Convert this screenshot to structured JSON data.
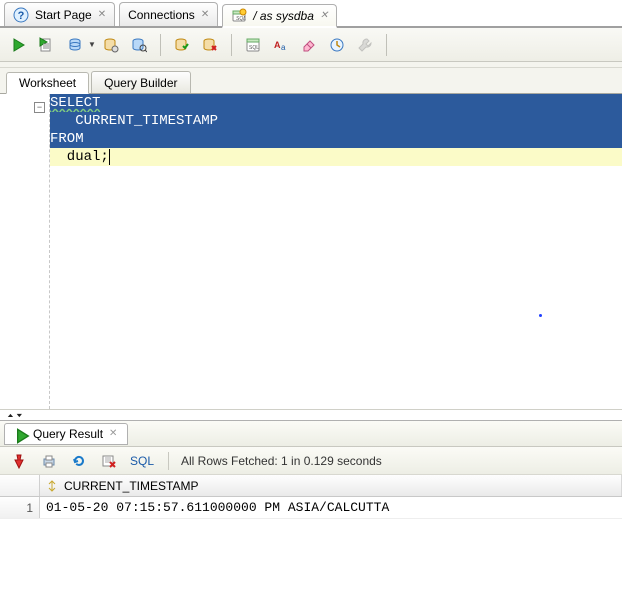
{
  "tabs": {
    "start": "Start Page",
    "connections": "Connections",
    "current": "/ as sysdba"
  },
  "worksheet": {
    "tab1": "Worksheet",
    "tab2": "Query Builder"
  },
  "sql": {
    "line1": "SELECT",
    "line2": "   CURRENT_TIMESTAMP",
    "line3": "FROM",
    "line4": "  dual;"
  },
  "result": {
    "tab_label": "Query Result",
    "sql_label": "SQL",
    "status": "All Rows Fetched: 1 in 0.129 seconds",
    "columns": [
      "CURRENT_TIMESTAMP"
    ],
    "rows": [
      {
        "n": "1",
        "value": "01-05-20 07:15:57.611000000 PM ASIA/CALCUTTA"
      }
    ]
  },
  "icons": {
    "run": "run-icon",
    "run_script": "run-script-icon",
    "db_dropdown": "db-select-icon",
    "refresh_db": "refresh-db-icon",
    "zoom_db": "zoom-db-icon",
    "commit": "commit-icon",
    "rollback": "rollback-icon",
    "sql_page": "sql-page-icon",
    "toggle_case": "toggle-case-icon",
    "eraser": "eraser-icon",
    "history": "history-icon",
    "tool_disabled": "disabled-tool-icon",
    "pin": "pin-icon",
    "print": "print-icon",
    "refresh": "refresh-icon",
    "delete_result": "delete-result-icon",
    "column_handle": "column-handle-icon"
  }
}
